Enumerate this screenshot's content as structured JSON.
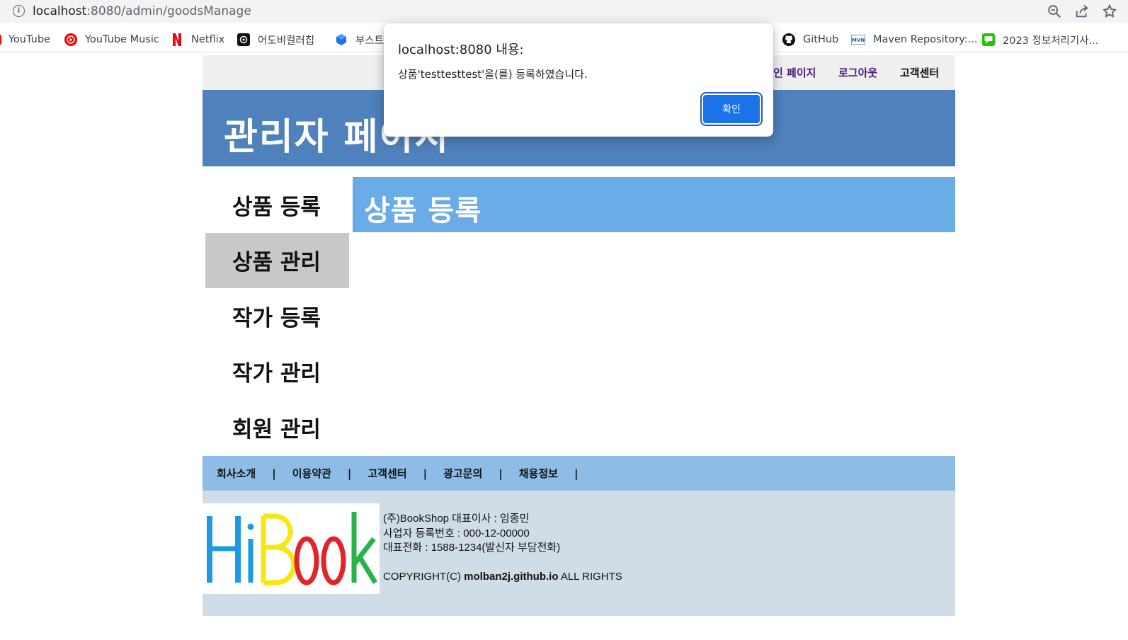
{
  "browser": {
    "url_host": "localhost",
    "url_rest": ":8080/admin/goodsManage",
    "bookmarks": [
      {
        "label": "YouTube",
        "icon": "youtube-icon"
      },
      {
        "label": "YouTube Music",
        "icon": "youtube-music-icon"
      },
      {
        "label": "Netflix",
        "icon": "netflix-icon"
      },
      {
        "label": "어도비컬러칩",
        "icon": "adobe-color-icon"
      },
      {
        "label": "부스트",
        "icon": "boost-icon"
      },
      {
        "label": "GitHub",
        "icon": "github-icon"
      },
      {
        "label": "Maven Repository:...",
        "icon": "maven-icon"
      },
      {
        "label": "2023 정보처리기사...",
        "icon": "chat-icon"
      }
    ]
  },
  "top_nav": {
    "mypage": "인 페이지",
    "logout": "로그아웃",
    "support": "고객센터"
  },
  "header": {
    "title": "관리자 페이지"
  },
  "side_menu": [
    {
      "label": "상품 등록",
      "active": false
    },
    {
      "label": "상품 관리",
      "active": true
    },
    {
      "label": "작가 등록",
      "active": false
    },
    {
      "label": "작가 관리",
      "active": false
    },
    {
      "label": "회원 관리",
      "active": false
    }
  ],
  "content": {
    "title": "상품 등록"
  },
  "footer_nav": [
    "회사소개",
    "이용약관",
    "고객센터",
    "광고문의",
    "채용정보"
  ],
  "footer_info": {
    "logo_text": "HiBook",
    "line1": "(주)BookShop 대표이사 : 임종민",
    "line2": "사업자 등록번호 : 000-12-00000",
    "line3": "대표전화 : 1588-1234(발신자 부담전화)",
    "copyright_prefix": "COPYRIGHT(C) ",
    "copyright_site": "molban2j.github.io",
    "copyright_suffix": " ALL RIGHTS"
  },
  "dialog": {
    "title": "localhost:8080 내용:",
    "message": "상품'testtesttest'을(를) 등록하였습니다.",
    "ok_label": "확인"
  },
  "colors": {
    "header_bg": "#4f81bd",
    "content_title_bg": "#6aace6",
    "footer_nav_bg": "#8ebce6",
    "footer_info_bg": "#d0dde6",
    "dialog_button": "#1a73e8",
    "nav_link": "#4b1a7a"
  }
}
